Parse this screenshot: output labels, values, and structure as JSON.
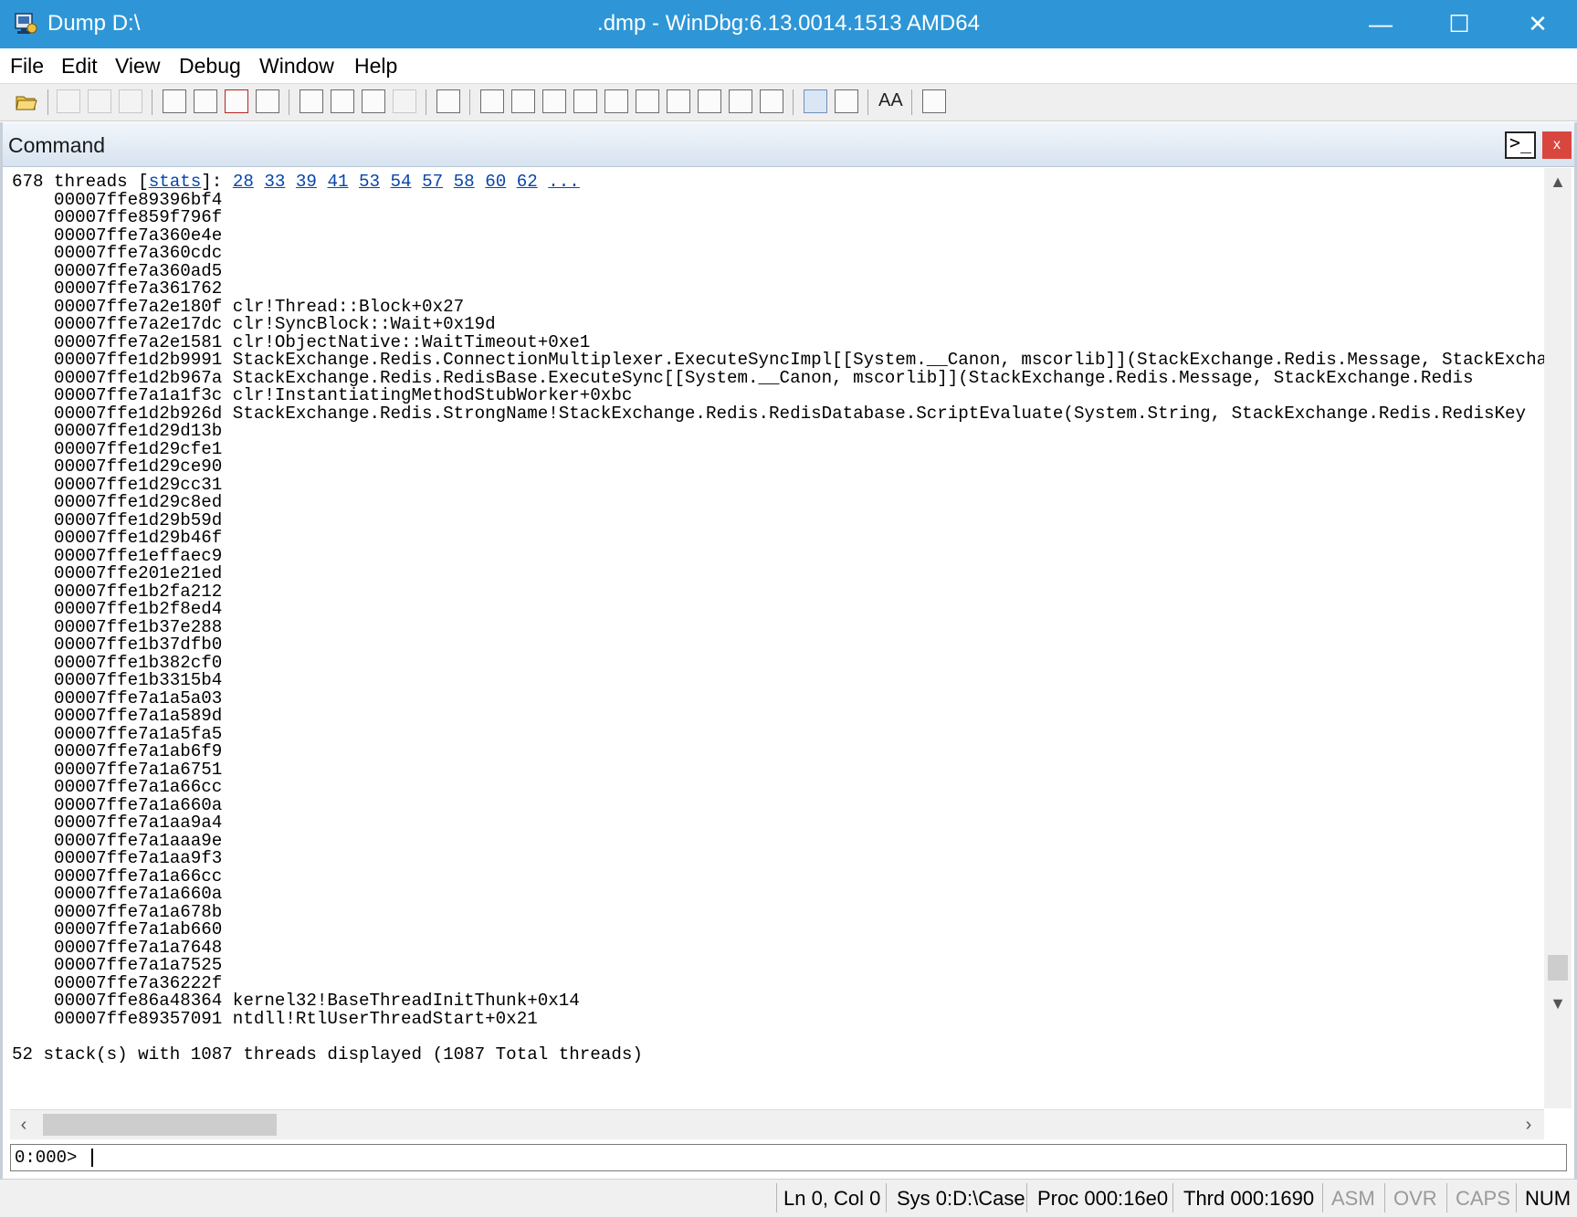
{
  "window": {
    "title_left": "Dump D:\\",
    "title_center": ".dmp - WinDbg:6.13.0014.1513 AMD64",
    "minimize": "—",
    "maximize": "☐",
    "close": "✕"
  },
  "menu": {
    "file": "File",
    "edit": "Edit",
    "view": "View",
    "debug": "Debug",
    "window": "Window",
    "help": "Help"
  },
  "toolbar": {
    "font_glyph": "AA",
    "icons": [
      "open-icon",
      "cut-icon",
      "copy-icon",
      "paste-icon",
      "step-into-icon",
      "step-over-icon",
      "break-icon",
      "restart-icon",
      "go-icon",
      "step-out-icon",
      "run-to-cursor-icon",
      "stop-icon",
      "hand-icon",
      "command-window-icon",
      "watch-icon",
      "locals-icon",
      "registers-icon",
      "memory-icon",
      "call-stack-icon",
      "disassembly-icon",
      "scratch-pad-icon",
      "processes-icon",
      "source-mode-icon",
      "hex-icon",
      "font-icon",
      "options-icon"
    ]
  },
  "pane": {
    "title": "Command",
    "cmd_glyph": ">_",
    "close_glyph": "x"
  },
  "output": {
    "header_prefix": "678 threads [",
    "header_stats_link": "stats",
    "header_mid": "]: ",
    "thread_links": [
      "28",
      "33",
      "39",
      "41",
      "53",
      "54",
      "57",
      "58",
      "60",
      "62",
      "..."
    ],
    "frames": [
      "    00007ffe89396bf4",
      "    00007ffe859f796f",
      "    00007ffe7a360e4e",
      "    00007ffe7a360cdc",
      "    00007ffe7a360ad5",
      "    00007ffe7a361762",
      "    00007ffe7a2e180f clr!Thread::Block+0x27",
      "    00007ffe7a2e17dc clr!SyncBlock::Wait+0x19d",
      "    00007ffe7a2e1581 clr!ObjectNative::WaitTimeout+0xe1",
      "    00007ffe1d2b9991 StackExchange.Redis.ConnectionMultiplexer.ExecuteSyncImpl[[System.__Canon, mscorlib]](StackExchange.Redis.Message, StackExchange",
      "    00007ffe1d2b967a StackExchange.Redis.RedisBase.ExecuteSync[[System.__Canon, mscorlib]](StackExchange.Redis.Message, StackExchange.Redis",
      "    00007ffe7a1a1f3c clr!InstantiatingMethodStubWorker+0xbc",
      "    00007ffe1d2b926d StackExchange.Redis.StrongName!StackExchange.Redis.RedisDatabase.ScriptEvaluate(System.String, StackExchange.Redis.RedisKey",
      "    00007ffe1d29d13b",
      "    00007ffe1d29cfe1",
      "    00007ffe1d29ce90",
      "    00007ffe1d29cc31",
      "    00007ffe1d29c8ed",
      "    00007ffe1d29b59d",
      "    00007ffe1d29b46f",
      "    00007ffe1effaec9",
      "    00007ffe201e21ed",
      "    00007ffe1b2fa212",
      "    00007ffe1b2f8ed4",
      "    00007ffe1b37e288",
      "    00007ffe1b37dfb0",
      "    00007ffe1b382cf0",
      "    00007ffe1b3315b4",
      "    00007ffe7a1a5a03",
      "    00007ffe7a1a589d",
      "    00007ffe7a1a5fa5",
      "    00007ffe7a1ab6f9",
      "    00007ffe7a1a6751",
      "    00007ffe7a1a66cc",
      "    00007ffe7a1a660a",
      "    00007ffe7a1aa9a4",
      "    00007ffe7a1aaa9e",
      "    00007ffe7a1aa9f3",
      "    00007ffe7a1a66cc",
      "    00007ffe7a1a660a",
      "    00007ffe7a1a678b",
      "    00007ffe7a1ab660",
      "    00007ffe7a1a7648",
      "    00007ffe7a1a7525",
      "    00007ffe7a36222f",
      "    00007ffe86a48364 kernel32!BaseThreadInitThunk+0x14",
      "    00007ffe89357091 ntdll!RtlUserThreadStart+0x21"
    ],
    "summary": "52 stack(s) with 1087 threads displayed (1087 Total threads)"
  },
  "command": {
    "prompt": "0:000>",
    "value": ""
  },
  "status": {
    "position": "Ln 0, Col 0",
    "sys": "Sys 0:D:\\Case",
    "proc": "Proc 000:16e0",
    "thrd": "Thrd 000:1690",
    "asm": "ASM",
    "ovr": "OVR",
    "caps": "CAPS",
    "num": "NUM"
  },
  "colors": {
    "titlebar": "#2e96d6",
    "link": "#0645ad",
    "pane_close": "#d9463e"
  }
}
